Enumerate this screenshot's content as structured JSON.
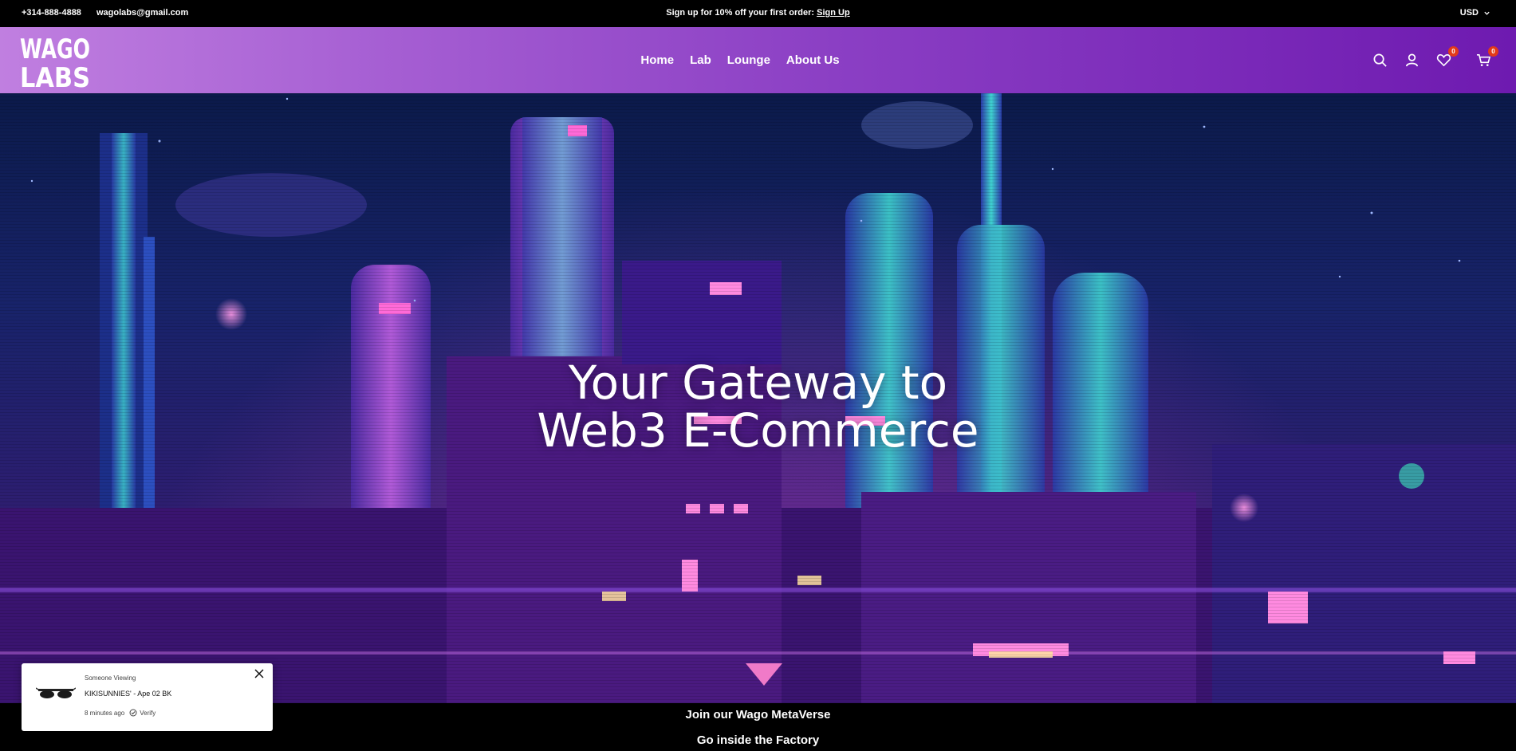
{
  "topbar": {
    "phone": "+314-888-4888",
    "email": "wagolabs@gmail.com",
    "promo_text": "Sign up for 10% off your first order:",
    "promo_link": "Sign Up",
    "currency": "USD"
  },
  "header": {
    "logo_text": "WAGO LABS",
    "nav": [
      {
        "label": "Home"
      },
      {
        "label": "Lab"
      },
      {
        "label": "Lounge"
      },
      {
        "label": "About Us"
      }
    ],
    "wishlist_count": "0",
    "cart_count": "0"
  },
  "hero": {
    "title_line1": "Your Gateway to",
    "title_line2": "Web3 E-Commerce"
  },
  "band": {
    "line1": "Join our Wago MetaVerse",
    "line2": "Go inside the Factory"
  },
  "popup": {
    "label": "Someone Viewing",
    "product": "KIKISUNNIES' - Ape 02 BK",
    "time": "8  minutes ago",
    "verify": "Verify"
  },
  "colors": {
    "header_start": "#c07fe0",
    "header_end": "#6e1ab0",
    "badge": "#e23a19",
    "arrow": "#f07ac8"
  }
}
